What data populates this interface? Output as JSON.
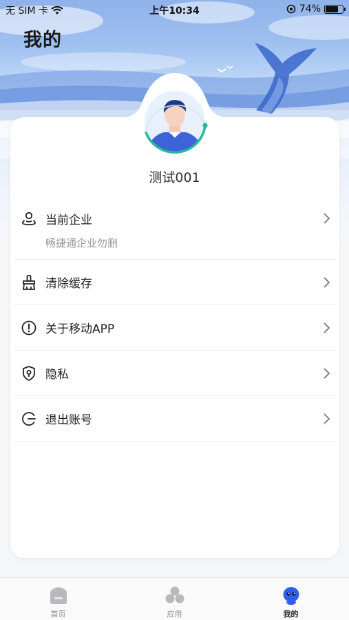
{
  "status_bar": {
    "carrier": "无 SIM 卡",
    "time": "上午10:34",
    "battery_percent": "74%",
    "battery_level": 0.74
  },
  "page_title": "我的",
  "profile": {
    "username": "测试001"
  },
  "menu": {
    "items": [
      {
        "label": "当前企业",
        "sublabel": "畅捷通企业勿删",
        "icon": "location-person-icon"
      },
      {
        "label": "清除缓存",
        "icon": "broom-icon"
      },
      {
        "label": "关于移动APP",
        "icon": "info-circle-icon"
      },
      {
        "label": "隐私",
        "icon": "shield-icon"
      },
      {
        "label": "退出账号",
        "icon": "logout-icon"
      }
    ]
  },
  "tab_bar": {
    "tabs": [
      {
        "label": "首页",
        "icon": "home-icon",
        "active": false
      },
      {
        "label": "应用",
        "icon": "apps-icon",
        "active": false
      },
      {
        "label": "我的",
        "icon": "robot-icon",
        "active": true
      }
    ]
  },
  "colors": {
    "accent": "#2f5fe8",
    "avatar_ring": "#2bb89a",
    "text_primary": "#222222",
    "text_secondary": "#999999"
  }
}
